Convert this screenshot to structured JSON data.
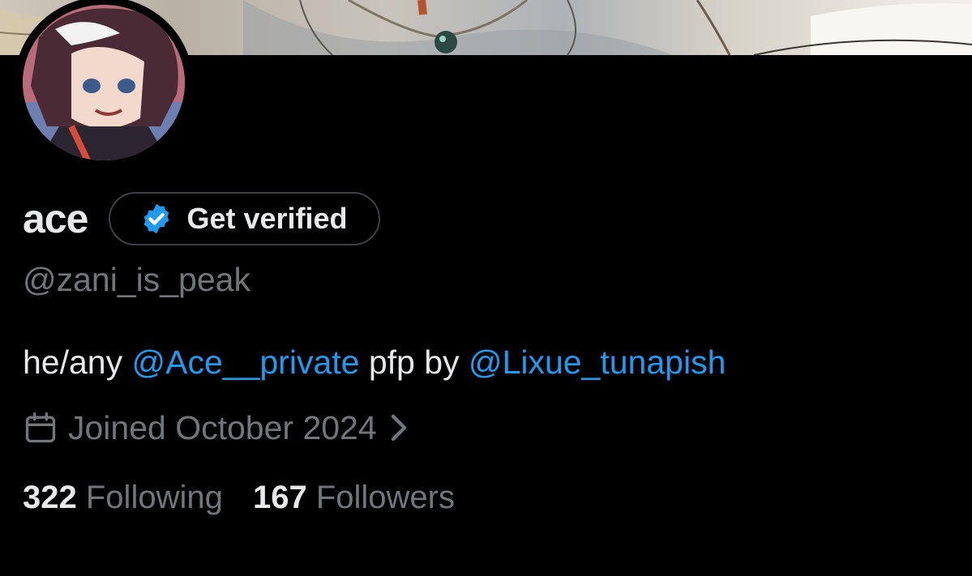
{
  "profile": {
    "display_name": "ace",
    "get_verified_label": "Get verified",
    "handle": "@zani_is_peak",
    "bio": {
      "prefix": "he/any ",
      "mention_1": "@Ace__private",
      "middle": " pfp by ",
      "mention_2": "@Lixue_tunapish"
    },
    "joined": "Joined October 2024",
    "stats": {
      "following_count": "322",
      "following_label": "Following",
      "followers_count": "167",
      "followers_label": "Followers"
    }
  },
  "icons": {
    "verified_badge": "verified-badge-icon",
    "calendar": "calendar-icon",
    "chevron": "chevron-right-icon"
  },
  "colors": {
    "background": "#000000",
    "primary_text": "#e7e9ea",
    "secondary_text": "#71767b",
    "link": "#1d9bf0",
    "button_border": "#3e4144"
  }
}
